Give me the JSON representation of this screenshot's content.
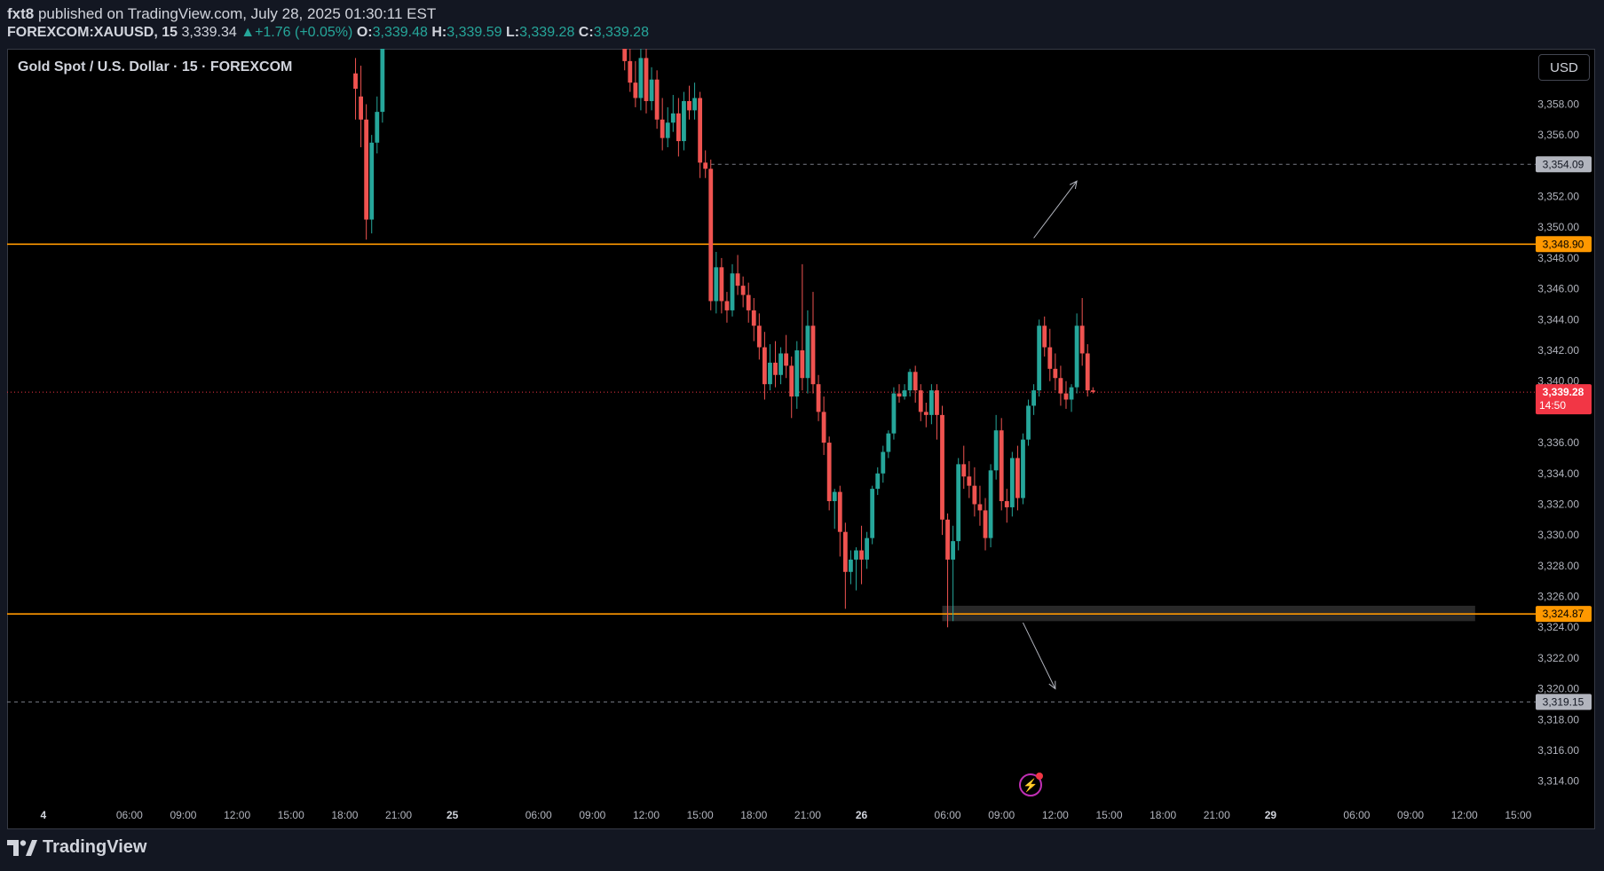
{
  "header": {
    "user": "fxt8",
    "published_text": " published on TradingView.com, July 28, 2025 01:30:11 EST",
    "symbol": "FOREXCOM:XAUUSD, 15",
    "last": "3,339.34",
    "change": "+1.76 (+0.05%)",
    "o_label": "O:",
    "o_value": "3,339.48",
    "h_label": "H:",
    "h_value": "3,339.59",
    "l_label": "L:",
    "l_value": "3,339.28",
    "c_label": "C:",
    "c_value": "3,339.28"
  },
  "chart_title": "Gold Spot / U.S. Dollar · 15 · FOREXCOM",
  "currency_button": "USD",
  "footer": {
    "brand": "TradingView"
  },
  "colors": {
    "up": "#26a69a",
    "down": "#ef5350",
    "level": "#ff9800",
    "background": "#000000"
  },
  "chart_data": {
    "type": "candlestick",
    "title": "Gold Spot / U.S. Dollar · 15 · FOREXCOM",
    "y_range": [
      3312.6,
      3361.6
    ],
    "y_ticks": [
      "3,314.00",
      "3,316.00",
      "3,318.00",
      "3,320.00",
      "3,322.00",
      "3,324.00",
      "3,326.00",
      "3,328.00",
      "3,330.00",
      "3,332.00",
      "3,334.00",
      "3,336.00",
      "3,340.00",
      "3,342.00",
      "3,344.00",
      "3,346.00",
      "3,348.00",
      "3,350.00",
      "3,352.00",
      "3,354.00",
      "3,356.00",
      "3,358.00"
    ],
    "x_labels": [
      {
        "label": "4",
        "slot": -70
      },
      {
        "label": "06:00",
        "slot": -54
      },
      {
        "label": "09:00",
        "slot": -44
      },
      {
        "label": "12:00",
        "slot": -34
      },
      {
        "label": "15:00",
        "slot": -24
      },
      {
        "label": "18:00",
        "slot": -14
      },
      {
        "label": "21:00",
        "slot": -4
      },
      {
        "label": "25",
        "slot": 6
      },
      {
        "label": "06:00",
        "slot": 22
      },
      {
        "label": "09:00",
        "slot": 32
      },
      {
        "label": "12:00",
        "slot": 42
      },
      {
        "label": "15:00",
        "slot": 52
      },
      {
        "label": "18:00",
        "slot": 62
      },
      {
        "label": "21:00",
        "slot": 72
      },
      {
        "label": "26",
        "slot": 82
      },
      {
        "label": "06:00",
        "slot": 98
      },
      {
        "label": "09:00",
        "slot": 108
      },
      {
        "label": "12:00",
        "slot": 118
      },
      {
        "label": "15:00",
        "slot": 128
      },
      {
        "label": "18:00",
        "slot": 138
      },
      {
        "label": "21:00",
        "slot": 148
      },
      {
        "label": "29",
        "slot": 158
      },
      {
        "label": "06:00",
        "slot": 174
      },
      {
        "label": "09:00",
        "slot": 184
      },
      {
        "label": "12:00",
        "slot": 194
      },
      {
        "label": "15:00",
        "slot": 204
      }
    ],
    "candles": [
      {
        "slot": -12,
        "o": 3360.0,
        "h": 3361.0,
        "c": 3359.0,
        "l": 3357.0
      },
      {
        "slot": -11,
        "o": 3358.5,
        "h": 3360.5,
        "c": 3357.0,
        "l": 3355.2
      },
      {
        "slot": -10,
        "o": 3357.0,
        "h": 3358.0,
        "c": 3350.5,
        "l": 3349.2
      },
      {
        "slot": -9,
        "o": 3350.5,
        "h": 3356.0,
        "c": 3355.5,
        "l": 3349.6
      },
      {
        "slot": -8,
        "o": 3355.5,
        "h": 3358.5,
        "c": 3357.5,
        "l": 3354.8
      },
      {
        "slot": -7,
        "o": 3357.5,
        "h": 3361.6,
        "c": 3361.6,
        "l": 3356.8
      },
      {
        "slot": 38,
        "o": 3361.6,
        "h": 3361.6,
        "c": 3360.8,
        "l": 3360.2
      },
      {
        "slot": 39,
        "o": 3360.8,
        "h": 3361.6,
        "c": 3359.4,
        "l": 3358.8
      },
      {
        "slot": 40,
        "o": 3359.4,
        "h": 3360.8,
        "c": 3358.4,
        "l": 3357.8
      },
      {
        "slot": 41,
        "o": 3358.4,
        "h": 3361.6,
        "c": 3361.0,
        "l": 3357.6
      },
      {
        "slot": 42,
        "o": 3361.0,
        "h": 3361.6,
        "c": 3358.2,
        "l": 3357.4
      },
      {
        "slot": 43,
        "o": 3358.2,
        "h": 3360.4,
        "c": 3359.6,
        "l": 3357.6
      },
      {
        "slot": 44,
        "o": 3359.6,
        "h": 3360.2,
        "c": 3357.0,
        "l": 3356.4
      },
      {
        "slot": 45,
        "o": 3357.0,
        "h": 3358.4,
        "c": 3355.8,
        "l": 3355.0
      },
      {
        "slot": 46,
        "o": 3355.8,
        "h": 3357.8,
        "c": 3356.8,
        "l": 3355.2
      },
      {
        "slot": 47,
        "o": 3356.8,
        "h": 3358.6,
        "c": 3357.4,
        "l": 3356.2
      },
      {
        "slot": 48,
        "o": 3357.4,
        "h": 3358.4,
        "c": 3355.6,
        "l": 3354.6
      },
      {
        "slot": 49,
        "o": 3355.6,
        "h": 3358.8,
        "c": 3358.2,
        "l": 3355.0
      },
      {
        "slot": 50,
        "o": 3358.2,
        "h": 3359.2,
        "c": 3357.6,
        "l": 3357.0
      },
      {
        "slot": 51,
        "o": 3357.6,
        "h": 3359.4,
        "c": 3358.4,
        "l": 3357.0
      },
      {
        "slot": 52,
        "o": 3358.4,
        "h": 3358.8,
        "c": 3354.2,
        "l": 3353.2
      },
      {
        "slot": 53,
        "o": 3354.2,
        "h": 3355.0,
        "c": 3353.8,
        "l": 3353.2
      },
      {
        "slot": 54,
        "o": 3353.8,
        "h": 3354.4,
        "c": 3345.2,
        "l": 3344.6
      },
      {
        "slot": 55,
        "o": 3345.2,
        "h": 3348.4,
        "c": 3347.4,
        "l": 3344.4
      },
      {
        "slot": 56,
        "o": 3347.4,
        "h": 3348.0,
        "c": 3345.2,
        "l": 3344.4
      },
      {
        "slot": 57,
        "o": 3345.2,
        "h": 3345.8,
        "c": 3344.6,
        "l": 3343.8
      },
      {
        "slot": 58,
        "o": 3344.6,
        "h": 3347.6,
        "c": 3347.0,
        "l": 3344.2
      },
      {
        "slot": 59,
        "o": 3347.0,
        "h": 3348.2,
        "c": 3346.2,
        "l": 3345.6
      },
      {
        "slot": 60,
        "o": 3346.2,
        "h": 3346.8,
        "c": 3345.6,
        "l": 3344.8
      },
      {
        "slot": 61,
        "o": 3345.6,
        "h": 3346.4,
        "c": 3344.6,
        "l": 3343.8
      },
      {
        "slot": 62,
        "o": 3344.6,
        "h": 3345.4,
        "c": 3343.6,
        "l": 3342.6
      },
      {
        "slot": 63,
        "o": 3343.6,
        "h": 3344.4,
        "c": 3342.2,
        "l": 3341.4
      },
      {
        "slot": 64,
        "o": 3342.2,
        "h": 3343.2,
        "c": 3339.8,
        "l": 3338.8
      },
      {
        "slot": 65,
        "o": 3339.8,
        "h": 3342.4,
        "c": 3341.2,
        "l": 3339.4
      },
      {
        "slot": 66,
        "o": 3341.2,
        "h": 3342.6,
        "c": 3340.4,
        "l": 3339.6
      },
      {
        "slot": 67,
        "o": 3340.4,
        "h": 3342.2,
        "c": 3341.8,
        "l": 3339.8
      },
      {
        "slot": 68,
        "o": 3341.8,
        "h": 3343.0,
        "c": 3341.0,
        "l": 3340.2
      },
      {
        "slot": 69,
        "o": 3341.0,
        "h": 3341.6,
        "c": 3339.0,
        "l": 3337.6
      },
      {
        "slot": 70,
        "o": 3339.0,
        "h": 3342.6,
        "c": 3342.0,
        "l": 3338.2
      },
      {
        "slot": 71,
        "o": 3342.0,
        "h": 3347.6,
        "c": 3340.2,
        "l": 3339.4
      },
      {
        "slot": 72,
        "o": 3340.2,
        "h": 3344.6,
        "c": 3343.6,
        "l": 3339.2
      },
      {
        "slot": 73,
        "o": 3343.6,
        "h": 3345.8,
        "c": 3339.8,
        "l": 3339.2
      },
      {
        "slot": 74,
        "o": 3339.8,
        "h": 3340.4,
        "c": 3338.0,
        "l": 3337.4
      },
      {
        "slot": 75,
        "o": 3338.0,
        "h": 3339.0,
        "c": 3336.0,
        "l": 3335.2
      },
      {
        "slot": 76,
        "o": 3336.0,
        "h": 3336.4,
        "c": 3332.2,
        "l": 3331.6
      },
      {
        "slot": 77,
        "o": 3332.2,
        "h": 3333.0,
        "c": 3332.8,
        "l": 3330.4
      },
      {
        "slot": 78,
        "o": 3332.8,
        "h": 3333.2,
        "c": 3330.2,
        "l": 3328.6
      },
      {
        "slot": 79,
        "o": 3330.2,
        "h": 3330.8,
        "c": 3327.6,
        "l": 3325.2
      },
      {
        "slot": 80,
        "o": 3327.6,
        "h": 3329.0,
        "c": 3328.4,
        "l": 3326.8
      },
      {
        "slot": 81,
        "o": 3328.4,
        "h": 3329.2,
        "c": 3329.0,
        "l": 3326.4
      },
      {
        "slot": 82,
        "o": 3329.0,
        "h": 3330.6,
        "c": 3328.4,
        "l": 3326.8
      },
      {
        "slot": 83,
        "o": 3328.4,
        "h": 3330.2,
        "c": 3329.8,
        "l": 3327.8
      },
      {
        "slot": 84,
        "o": 3329.8,
        "h": 3333.2,
        "c": 3333.0,
        "l": 3329.4
      },
      {
        "slot": 85,
        "o": 3333.0,
        "h": 3334.4,
        "c": 3334.0,
        "l": 3332.6
      },
      {
        "slot": 86,
        "o": 3334.0,
        "h": 3335.8,
        "c": 3335.4,
        "l": 3333.4
      },
      {
        "slot": 87,
        "o": 3335.4,
        "h": 3336.8,
        "c": 3336.6,
        "l": 3335.0
      },
      {
        "slot": 88,
        "o": 3336.6,
        "h": 3339.6,
        "c": 3339.2,
        "l": 3336.2
      },
      {
        "slot": 89,
        "o": 3339.2,
        "h": 3339.8,
        "c": 3339.0,
        "l": 3338.6
      },
      {
        "slot": 90,
        "o": 3339.0,
        "h": 3339.8,
        "c": 3339.4,
        "l": 3338.8
      },
      {
        "slot": 91,
        "o": 3339.4,
        "h": 3340.8,
        "c": 3340.6,
        "l": 3339.0
      },
      {
        "slot": 92,
        "o": 3340.6,
        "h": 3341.0,
        "c": 3339.4,
        "l": 3338.6
      },
      {
        "slot": 93,
        "o": 3339.4,
        "h": 3339.8,
        "c": 3338.0,
        "l": 3337.4
      },
      {
        "slot": 94,
        "o": 3338.0,
        "h": 3338.6,
        "c": 3337.8,
        "l": 3337.0
      },
      {
        "slot": 95,
        "o": 3337.8,
        "h": 3339.8,
        "c": 3339.4,
        "l": 3337.2
      },
      {
        "slot": 96,
        "o": 3339.4,
        "h": 3339.8,
        "c": 3337.8,
        "l": 3336.2
      },
      {
        "slot": 97,
        "o": 3337.8,
        "h": 3338.4,
        "c": 3331.0,
        "l": 3330.0
      },
      {
        "slot": 98,
        "o": 3331.0,
        "h": 3331.4,
        "c": 3328.4,
        "l": 3324.0
      },
      {
        "slot": 99,
        "o": 3328.4,
        "h": 3330.6,
        "c": 3329.6,
        "l": 3324.4
      },
      {
        "slot": 100,
        "o": 3329.6,
        "h": 3335.0,
        "c": 3334.6,
        "l": 3329.0
      },
      {
        "slot": 101,
        "o": 3334.6,
        "h": 3335.8,
        "c": 3333.8,
        "l": 3333.0
      },
      {
        "slot": 102,
        "o": 3333.8,
        "h": 3334.8,
        "c": 3333.2,
        "l": 3332.4
      },
      {
        "slot": 103,
        "o": 3333.2,
        "h": 3334.4,
        "c": 3332.0,
        "l": 3331.2
      },
      {
        "slot": 104,
        "o": 3332.0,
        "h": 3333.2,
        "c": 3331.6,
        "l": 3330.6
      },
      {
        "slot": 105,
        "o": 3331.6,
        "h": 3332.4,
        "c": 3329.8,
        "l": 3329.0
      },
      {
        "slot": 106,
        "o": 3329.8,
        "h": 3334.6,
        "c": 3334.2,
        "l": 3329.2
      },
      {
        "slot": 107,
        "o": 3334.2,
        "h": 3337.8,
        "c": 3336.8,
        "l": 3333.6
      },
      {
        "slot": 108,
        "o": 3336.8,
        "h": 3337.6,
        "c": 3332.2,
        "l": 3331.6
      },
      {
        "slot": 109,
        "o": 3332.2,
        "h": 3333.0,
        "c": 3331.8,
        "l": 3330.8
      },
      {
        "slot": 110,
        "o": 3331.8,
        "h": 3335.4,
        "c": 3335.0,
        "l": 3331.2
      },
      {
        "slot": 111,
        "o": 3335.0,
        "h": 3335.8,
        "c": 3332.4,
        "l": 3331.6
      },
      {
        "slot": 112,
        "o": 3332.4,
        "h": 3336.6,
        "c": 3336.2,
        "l": 3332.0
      },
      {
        "slot": 113,
        "o": 3336.2,
        "h": 3338.8,
        "c": 3338.4,
        "l": 3335.8
      },
      {
        "slot": 114,
        "o": 3338.4,
        "h": 3339.8,
        "c": 3339.4,
        "l": 3337.8
      },
      {
        "slot": 115,
        "o": 3339.4,
        "h": 3344.0,
        "c": 3343.6,
        "l": 3339.0
      },
      {
        "slot": 116,
        "o": 3343.6,
        "h": 3344.2,
        "c": 3342.2,
        "l": 3341.6
      },
      {
        "slot": 117,
        "o": 3342.2,
        "h": 3343.4,
        "c": 3340.8,
        "l": 3340.0
      },
      {
        "slot": 118,
        "o": 3340.8,
        "h": 3341.8,
        "c": 3340.2,
        "l": 3339.4
      },
      {
        "slot": 119,
        "o": 3340.2,
        "h": 3341.0,
        "c": 3339.2,
        "l": 3338.4
      },
      {
        "slot": 120,
        "o": 3339.2,
        "h": 3340.0,
        "c": 3338.8,
        "l": 3338.2
      },
      {
        "slot": 121,
        "o": 3338.8,
        "h": 3339.8,
        "c": 3339.6,
        "l": 3338.0
      },
      {
        "slot": 122,
        "o": 3339.6,
        "h": 3344.4,
        "c": 3343.6,
        "l": 3339.2
      },
      {
        "slot": 123,
        "o": 3343.6,
        "h": 3345.4,
        "c": 3341.8,
        "l": 3341.0
      },
      {
        "slot": 124,
        "o": 3341.8,
        "h": 3342.4,
        "c": 3339.4,
        "l": 3339.0
      },
      {
        "slot": 125,
        "o": 3339.4,
        "h": 3339.6,
        "c": 3339.3,
        "l": 3339.2
      }
    ],
    "levels": [
      {
        "price": 3348.9,
        "label": "3,348.90",
        "style": "solid",
        "color": "#ff9800"
      },
      {
        "price": 3324.87,
        "label": "3,324.87",
        "style": "solid",
        "color": "#ff9800"
      },
      {
        "price": 3354.09,
        "label": "3,354.09",
        "style": "dashed",
        "color": "#787b86"
      },
      {
        "price": 3319.15,
        "label": "3,319.15",
        "style": "dashed",
        "color": "#787b86"
      }
    ],
    "last_price": {
      "price": 3339.28,
      "label": "3,339.28",
      "countdown": "14:50",
      "color": "#f23645"
    },
    "arrows": [
      {
        "from": {
          "slot": 114,
          "price": 3349.3
        },
        "to": {
          "slot": 122,
          "price": 3353.0
        }
      },
      {
        "from": {
          "slot": 112,
          "price": 3324.3
        },
        "to": {
          "slot": 118,
          "price": 3320.0
        }
      }
    ],
    "zone": {
      "slot_start": 97,
      "slot_end": 196,
      "price_low": 3324.4,
      "price_high": 3325.4
    }
  }
}
